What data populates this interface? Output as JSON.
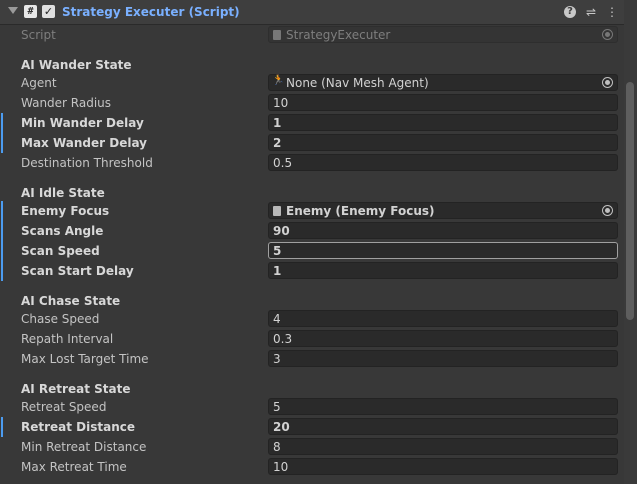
{
  "header": {
    "title": "Strategy Executer (Script)",
    "script_icon": "#",
    "checkbox_glyph": "✓",
    "help_icon": "question-icon",
    "presets_icon": "sliders-icon",
    "menu_icon": "kebab-icon"
  },
  "script_row": {
    "label": "Script",
    "value": "StrategyExecuter"
  },
  "wander": {
    "heading": "AI Wander State",
    "agent": {
      "label": "Agent",
      "value": "None (Nav Mesh Agent)"
    },
    "wander_radius": {
      "label": "Wander Radius",
      "value": "10"
    },
    "min_wander_delay": {
      "label": "Min Wander Delay",
      "value": "1"
    },
    "max_wander_delay": {
      "label": "Max Wander Delay",
      "value": "2"
    },
    "destination_threshold": {
      "label": "Destination Threshold",
      "value": "0.5"
    }
  },
  "idle": {
    "heading": "AI Idle State",
    "enemy_focus": {
      "label": "Enemy Focus",
      "value": "Enemy (Enemy Focus)"
    },
    "scans_angle": {
      "label": "Scans Angle",
      "value": "90"
    },
    "scan_speed": {
      "label": "Scan Speed",
      "value": "5"
    },
    "scan_start_delay": {
      "label": "Scan Start Delay",
      "value": "1"
    }
  },
  "chase": {
    "heading": "AI Chase State",
    "chase_speed": {
      "label": "Chase Speed",
      "value": "4"
    },
    "repath_interval": {
      "label": "Repath Interval",
      "value": "0.3"
    },
    "max_lost_target_time": {
      "label": "Max Lost Target Time",
      "value": "3"
    }
  },
  "retreat": {
    "heading": "AI Retreat State",
    "retreat_speed": {
      "label": "Retreat Speed",
      "value": "5"
    },
    "retreat_distance": {
      "label": "Retreat Distance",
      "value": "20"
    },
    "min_retreat_distance": {
      "label": "Min Retreat Distance",
      "value": "8"
    },
    "max_retreat_time": {
      "label": "Max Retreat Time",
      "value": "10"
    }
  },
  "colors": {
    "title": "#7ab0ff",
    "modified_bar": "#4c9cf0",
    "background": "#383838"
  }
}
